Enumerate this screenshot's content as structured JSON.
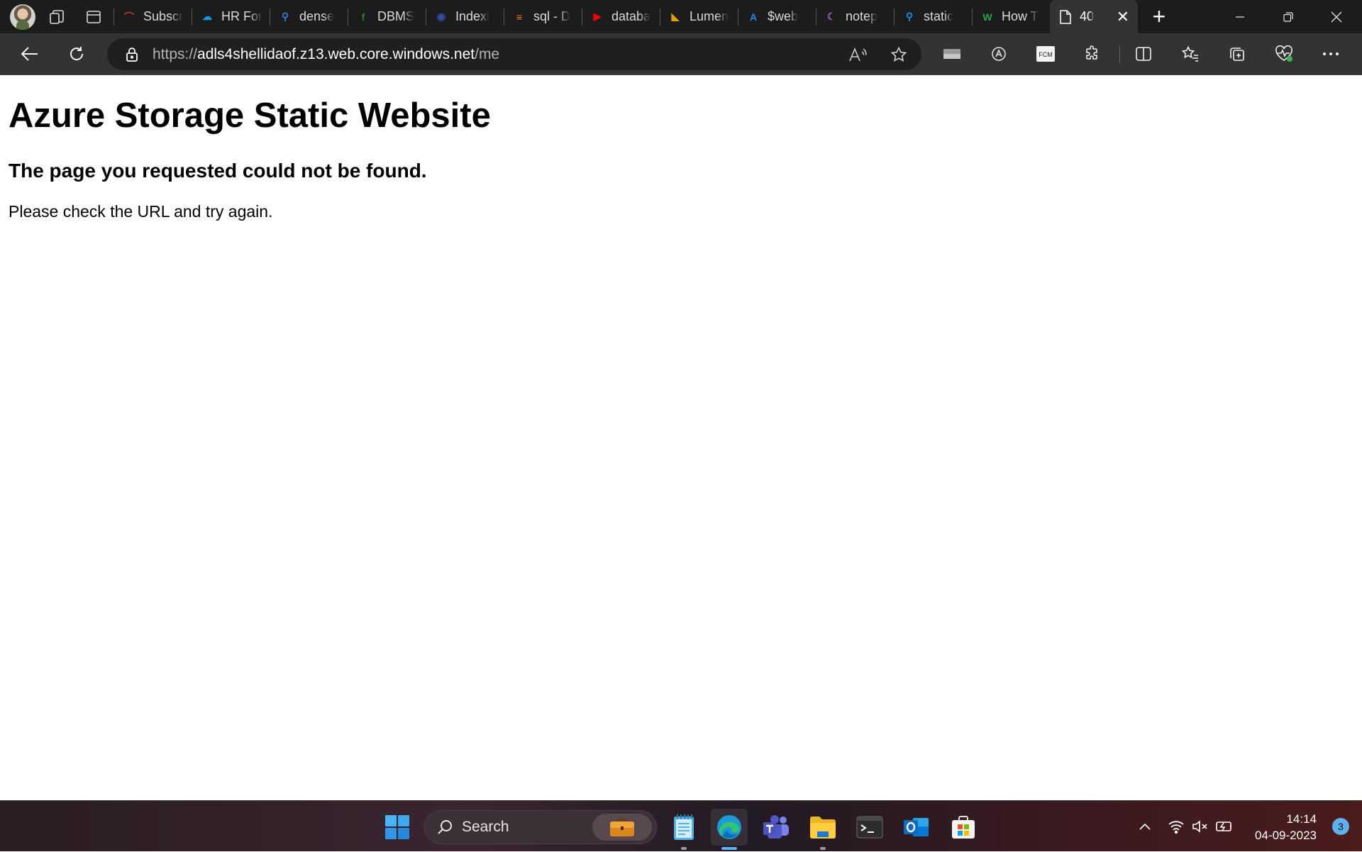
{
  "browser": {
    "tabs": [
      {
        "title": "Subscr",
        "icon": "subscription-icon",
        "color": "#c0392b"
      },
      {
        "title": "HR For",
        "icon": "salesforce-icon",
        "color": "#1b96e6"
      },
      {
        "title": "dense",
        "icon": "search-icon",
        "color": "#3a7bd5"
      },
      {
        "title": "DBMS",
        "icon": "dbms-icon",
        "color": "#2e7d32"
      },
      {
        "title": "Indexi",
        "icon": "globe-icon",
        "color": "#3949ab"
      },
      {
        "title": "sql - D",
        "icon": "stackoverflow-icon",
        "color": "#f48024"
      },
      {
        "title": "databa",
        "icon": "youtube-icon",
        "color": "#ff0000"
      },
      {
        "title": "Lumen",
        "icon": "lumen-icon",
        "color": "#e0a100"
      },
      {
        "title": "$web",
        "icon": "azure-icon",
        "color": "#1e88e5"
      },
      {
        "title": "notep",
        "icon": "notepad-icon",
        "color": "#9b59b6"
      },
      {
        "title": "static",
        "icon": "search-icon",
        "color": "#1e88e5"
      },
      {
        "title": "How T",
        "icon": "wikihow-icon",
        "color": "#2e9e4f"
      }
    ],
    "active_tab": {
      "title": "40",
      "icon": "page-icon",
      "close": "✕"
    },
    "new_tab": "+",
    "url": {
      "scheme": "https://",
      "host": "adls4shellidaof.z13.web.core.windows.net",
      "path": "/me"
    }
  },
  "page": {
    "heading": "Azure Storage Static Website",
    "subheading": "The page you requested could not be found.",
    "message": "Please check the URL and try again."
  },
  "taskbar": {
    "search_label": "Search",
    "time": "14:14",
    "date": "04-09-2023",
    "notifications": "3"
  }
}
